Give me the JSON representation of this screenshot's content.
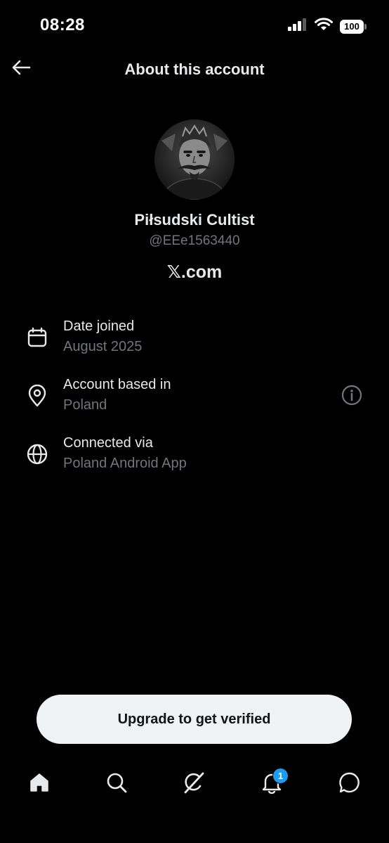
{
  "status_bar": {
    "time": "08:28",
    "battery": "100",
    "icons": [
      "cellular-signal-icon",
      "wifi-icon",
      "battery-icon"
    ]
  },
  "header": {
    "title": "About this account",
    "back_icon": "arrow-left-icon"
  },
  "profile": {
    "display_name": "Piłsudski Cultist",
    "handle": "@EEe1563440",
    "platform": "𝕏.com"
  },
  "details": [
    {
      "icon": "calendar-icon",
      "label": "Date joined",
      "value": "August 2025"
    },
    {
      "icon": "location-pin-icon",
      "label": "Account based in",
      "value": "Poland",
      "trailing_icon": "info-icon"
    },
    {
      "icon": "globe-icon",
      "label": "Connected via",
      "value": "Poland Android App"
    }
  ],
  "upgrade": {
    "label": "Upgrade to get verified"
  },
  "bottom_nav": {
    "items": [
      "home-icon",
      "search-icon",
      "grok-icon",
      "notifications-icon",
      "messages-icon"
    ],
    "notifications_badge": "1"
  },
  "colors": {
    "background": "#000000",
    "primary_text": "#e7e9ea",
    "secondary_text": "#71767b",
    "accent": "#1d9bf0",
    "button_bg": "#eff3f4"
  }
}
